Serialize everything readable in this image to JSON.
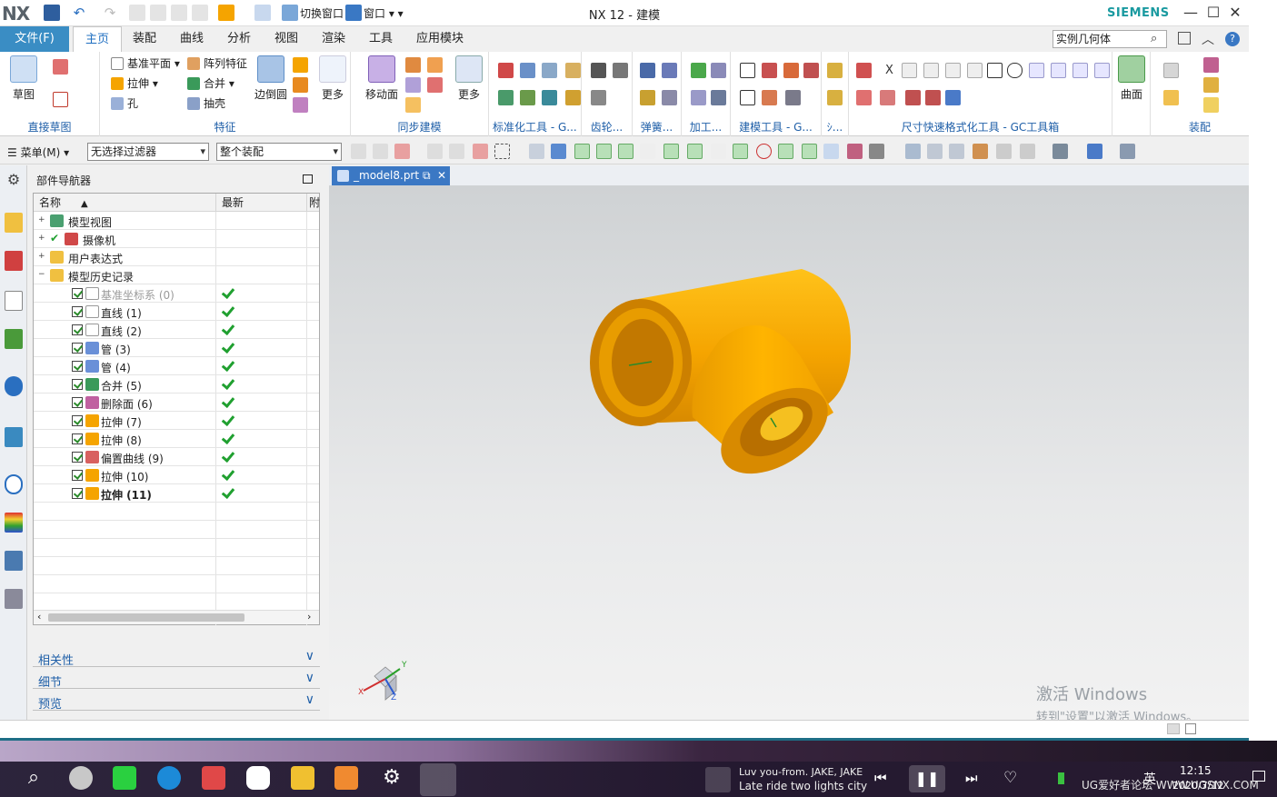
{
  "titlebar": {
    "logo": "NX",
    "title": "NX 12 - 建模",
    "brand": "SIEMENS",
    "min": "—",
    "max": "☐",
    "close": "✕"
  },
  "tabs": {
    "file": "文件(F)",
    "items": [
      "主页",
      "装配",
      "曲线",
      "分析",
      "视图",
      "渲染",
      "工具",
      "应用模块"
    ],
    "active": "主页"
  },
  "search": {
    "value": "实例几何体"
  },
  "ribbon": {
    "sketch": {
      "big": "草图",
      "group": "直接草图"
    },
    "feature": {
      "datum": "基准平面",
      "pattern": "阵列特征",
      "extrude": "拉伸",
      "unite": "合并",
      "hole": "孔",
      "shell": "抽壳",
      "edge_blend": "边倒圆",
      "more": "更多",
      "group": "特征"
    },
    "sync": {
      "move_face": "移动面",
      "more": "更多",
      "group": "同步建模"
    },
    "groups": {
      "standard": "标准化工具 - G...",
      "gear": "齿轮...",
      "spring": "弹簧...",
      "machining": "加工...",
      "modeling": "建模工具 - G...",
      "dots": "ｼ...",
      "dimension": "尺寸快速格式化工具 - GC工具箱",
      "surface_group": "曲面",
      "assembly_group": "装配"
    },
    "surface": "曲面"
  },
  "toolbar": {
    "menu": "菜单(M)",
    "filter": "无选择过滤器",
    "scope": "整个装配"
  },
  "navigator": {
    "title": "部件导航器",
    "columns": {
      "name": "名称",
      "latest": "最新",
      "extra": "附"
    },
    "folders": [
      "模型视图",
      "摄像机",
      "用户表达式",
      "模型历史记录"
    ],
    "features": [
      {
        "label": "基准坐标系 (0)",
        "dim": true
      },
      {
        "label": "直线 (1)"
      },
      {
        "label": "直线 (2)"
      },
      {
        "label": "管 (3)"
      },
      {
        "label": "管 (4)"
      },
      {
        "label": "合并 (5)"
      },
      {
        "label": "删除面 (6)"
      },
      {
        "label": "拉伸 (7)"
      },
      {
        "label": "拉伸 (8)"
      },
      {
        "label": "偏置曲线 (9)"
      },
      {
        "label": "拉伸 (10)"
      },
      {
        "label": "拉伸 (11)",
        "bold": true
      }
    ],
    "panels": [
      "相关性",
      "细节",
      "预览"
    ]
  },
  "document": {
    "tab": "_model8.prt"
  },
  "triad": {
    "x": "X",
    "y": "Y",
    "z": "Z"
  },
  "activation": {
    "line1": "激活 Windows",
    "line2": "转到\"设置\"以激活 Windows。"
  },
  "taskbar": {
    "song": "Luv you-from. JAKE, JAKE",
    "artist": "Late ride two lights city",
    "ime": "英",
    "time": "12:15",
    "date": "2020/7/12",
    "watermark": "UG爱好者论坛 WWW.UGSNX.COM"
  },
  "colors": {
    "accent": "#3a8dc4",
    "part": "#f5a400",
    "check": "#20a030"
  }
}
